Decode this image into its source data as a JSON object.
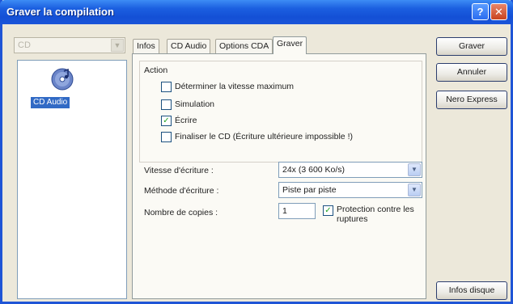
{
  "window": {
    "title": "Graver la compilation"
  },
  "left": {
    "recorder_combo_value": "CD",
    "items": [
      {
        "label": "CD Audio",
        "icon": "audio-cd-icon"
      }
    ]
  },
  "tabs": [
    {
      "label": "Infos",
      "active": false
    },
    {
      "label": "CD Audio",
      "active": false
    },
    {
      "label": "Options CDA",
      "active": false
    },
    {
      "label": "Graver",
      "active": true
    }
  ],
  "action": {
    "title": "Action",
    "options": [
      {
        "label": "Déterminer la vitesse maximum",
        "checked": false
      },
      {
        "label": "Simulation",
        "checked": false
      },
      {
        "label": "Écrire",
        "checked": true
      },
      {
        "label": "Finaliser le CD (Écriture ultérieure impossible !)",
        "checked": false
      }
    ]
  },
  "settings": {
    "speed_label": "Vitesse d'écriture :",
    "speed_value": "24x (3 600 Ko/s)",
    "method_label": "Méthode d'écriture :",
    "method_value": "Piste par piste",
    "copies_label": "Nombre de copies :",
    "copies_value": "1",
    "protection_label": "Protection contre les ruptures",
    "protection_checked": true
  },
  "buttons": {
    "burn": "Graver",
    "cancel": "Annuler",
    "nero_express": "Nero Express",
    "disc_info": "Infos disque"
  },
  "colors": {
    "titlebar": "#1450d6",
    "window_bg": "#ece8da",
    "selection": "#316ac5",
    "check": "#21a121"
  }
}
